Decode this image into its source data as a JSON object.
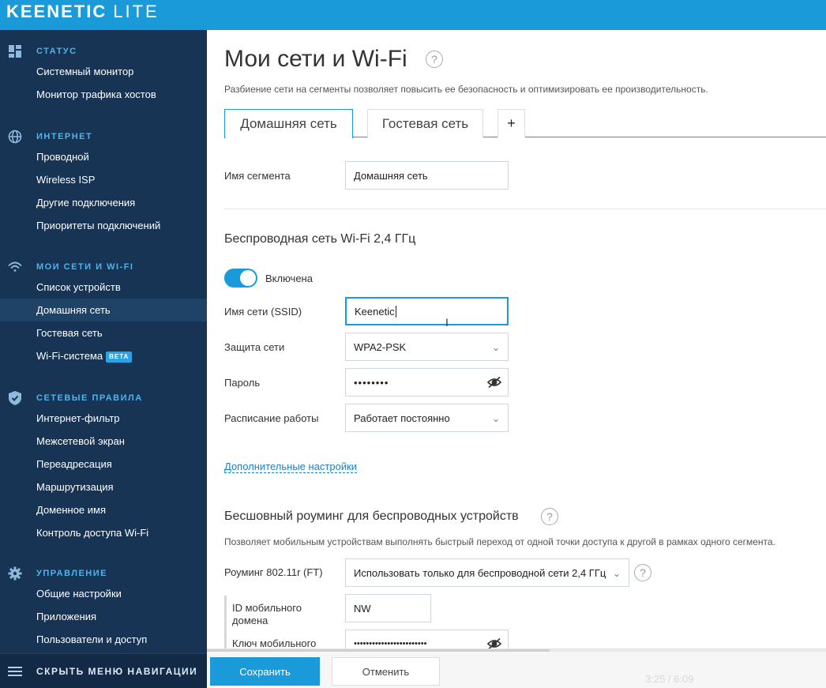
{
  "app": {
    "brand": "KEENETIC",
    "edition": "LITE"
  },
  "sidebar": {
    "groups": [
      {
        "title": "СТАТУС",
        "icon": "dashboard-icon",
        "items": [
          "Системный монитор",
          "Монитор трафика хостов"
        ]
      },
      {
        "title": "ИНТЕРНЕТ",
        "icon": "globe-icon",
        "items": [
          "Проводной",
          "Wireless ISP",
          "Другие подключения",
          "Приоритеты подключений"
        ]
      },
      {
        "title": "МОИ СЕТИ И WI-FI",
        "icon": "wifi-icon",
        "items": [
          "Список устройств",
          "Домашняя сеть",
          "Гостевая сеть",
          "Wi-Fi-система"
        ],
        "active_item": "Домашняя сеть",
        "badge": "BETA"
      },
      {
        "title": "СЕТЕВЫЕ ПРАВИЛА",
        "icon": "shield-icon",
        "items": [
          "Интернет-фильтр",
          "Межсетевой экран",
          "Переадресация",
          "Маршрутизация",
          "Доменное имя",
          "Контроль доступа Wi-Fi"
        ]
      },
      {
        "title": "УПРАВЛЕНИЕ",
        "icon": "gear-icon",
        "items": [
          "Общие настройки",
          "Приложения",
          "Пользователи и доступ"
        ]
      }
    ],
    "footer": "СКРЫТЬ МЕНЮ НАВИГАЦИИ"
  },
  "main": {
    "title": "Мои сети и Wi-Fi",
    "subtitle": "Разбиение сети на сегменты позволяет повысить ее безопасность и оптимизировать ее производительность.",
    "tabs": [
      {
        "label": "Домашняя сеть",
        "active": true
      },
      {
        "label": "Гостевая сеть",
        "active": false
      },
      {
        "label": "+",
        "active": false
      }
    ],
    "segment": {
      "label": "Имя сегмента",
      "value": "Домашняя сеть"
    },
    "wifi": {
      "section_title": "Беспроводная сеть Wi-Fi 2,4 ГГц",
      "toggle_label": "Включена",
      "enabled": true,
      "ssid_label": "Имя сети (SSID)",
      "ssid_value": "Keenetic",
      "security_label": "Защита сети",
      "security_value": "WPA2-PSK",
      "password_label": "Пароль",
      "password_value": "••••••••",
      "schedule_label": "Расписание работы",
      "schedule_value": "Работает постоянно",
      "advanced_link": "Дополнительные настройки"
    },
    "roaming": {
      "section_title": "Бесшовный роуминг для беспроводных устройств",
      "description": "Позволяет мобильным устройствам выполнять быстрый переход от одной точки доступа к другой в рамках одного сегмента.",
      "mode_label": "Роуминг 802.11r (FT)",
      "mode_value": "Использовать только для беспроводной сети 2,4 ГГц",
      "domain_id_label_1": "ID мобильного",
      "domain_id_label_2": "домена",
      "domain_id_value": "NW",
      "key_label": "Ключ мобильного",
      "key_value": "••••••••••••••••••••••••"
    }
  },
  "actions": {
    "save": "Сохранить",
    "cancel": "Отменить"
  },
  "video": {
    "time": "3:25 / 6:09",
    "progress": 0.554
  },
  "colors": {
    "accent": "#1a9ad8",
    "sidebar": "#173454",
    "section": "#4fb3ec"
  }
}
